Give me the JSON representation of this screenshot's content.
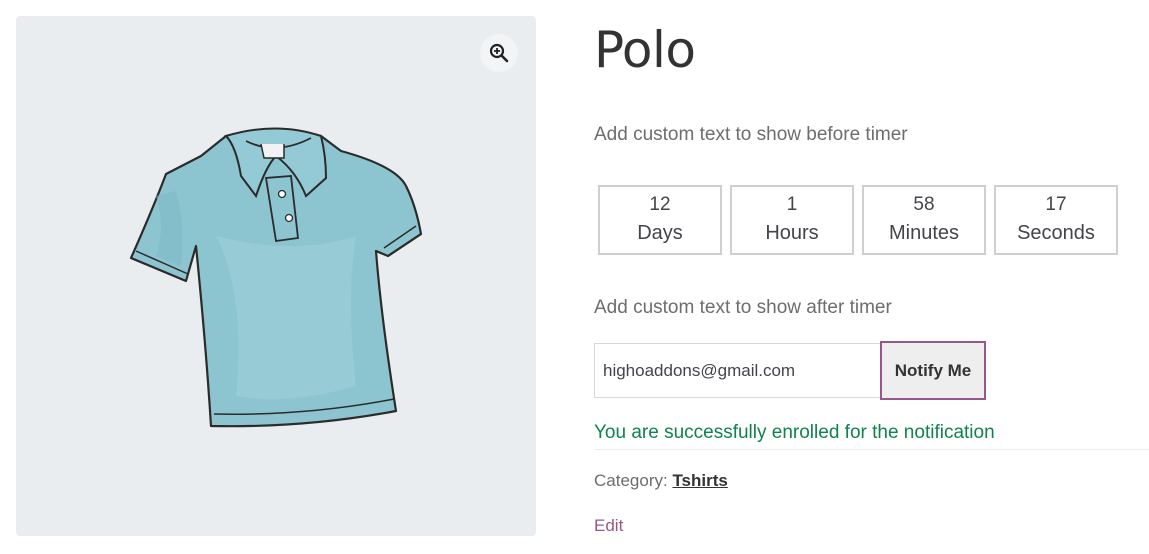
{
  "product": {
    "title": "Polo",
    "zoom_icon": "zoom-in-icon",
    "image_icon": "polo-shirt-illustration"
  },
  "timer": {
    "text_before": "Add custom text to show before timer",
    "text_after": "Add custom text to show after timer",
    "units": [
      {
        "value": "12",
        "label": "Days"
      },
      {
        "value": "1",
        "label": "Hours"
      },
      {
        "value": "58",
        "label": "Minutes"
      },
      {
        "value": "17",
        "label": "Seconds"
      }
    ]
  },
  "notify": {
    "email_value": "highoaddons@gmail.com",
    "button_label": "Notify Me",
    "success_message": "You are successfully enrolled for the notification"
  },
  "meta": {
    "category_label": "Category:",
    "category_value": "Tshirts",
    "edit_label": "Edit"
  },
  "colors": {
    "accent": "#96588a",
    "success": "#0f834d",
    "gallery_bg": "#eaedf0"
  }
}
